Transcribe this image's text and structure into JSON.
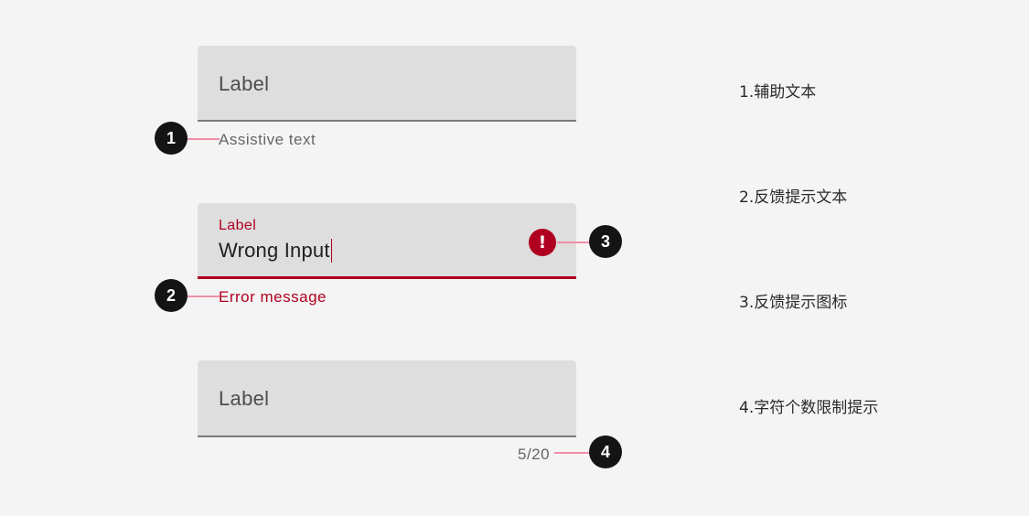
{
  "fields": [
    {
      "label": "Label",
      "helper": "Assistive text"
    },
    {
      "label": "Label",
      "value": "Wrong Input",
      "helper": "Error message",
      "icon": "error-exclamation-icon",
      "error_color": "#b00020"
    },
    {
      "label": "Label",
      "counter": "5/20"
    }
  ],
  "callouts": [
    "1",
    "2",
    "3",
    "4"
  ],
  "notes": [
    "1.辅助文本",
    "2.反馈提示文本",
    "3.反馈提示图标",
    "4.字符个数限制提示"
  ],
  "error_icon_glyph": "!",
  "colors": {
    "background": "#f4f4f4",
    "field": "#dedede",
    "error": "#b00020",
    "callout": "#141414",
    "leader": "#ef8fa6"
  }
}
